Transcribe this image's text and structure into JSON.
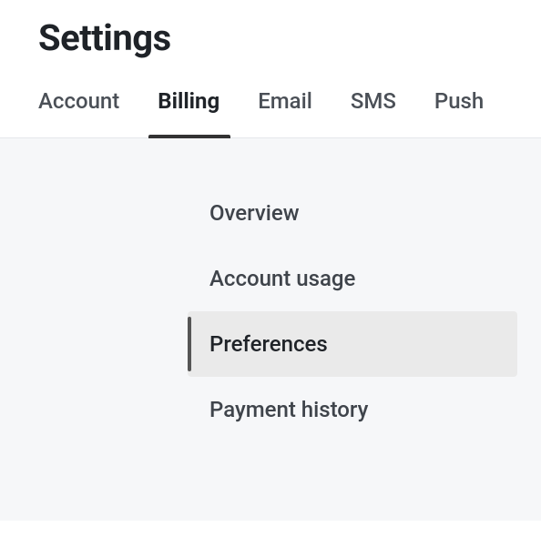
{
  "header": {
    "title": "Settings"
  },
  "tabs": [
    {
      "label": "Account",
      "selected": false
    },
    {
      "label": "Billing",
      "selected": true
    },
    {
      "label": "Email",
      "selected": false
    },
    {
      "label": "SMS",
      "selected": false
    },
    {
      "label": "Push",
      "selected": false
    }
  ],
  "sidebar": {
    "items": [
      {
        "label": "Overview",
        "selected": false
      },
      {
        "label": "Account usage",
        "selected": false
      },
      {
        "label": "Preferences",
        "selected": true
      },
      {
        "label": "Payment history",
        "selected": false
      }
    ]
  }
}
